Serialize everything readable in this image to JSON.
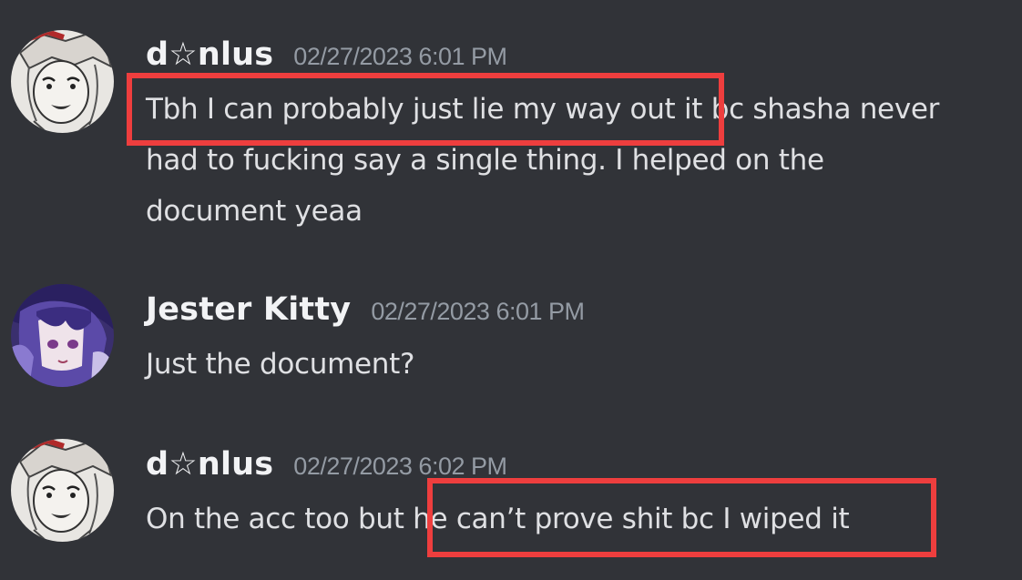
{
  "messages": [
    {
      "username": "d☆nlus",
      "timestamp": "02/27/2023 6:01 PM",
      "lines": [
        "Tbh I can probably just lie my way out it bc shasha never",
        "had to fucking say a single thing. I helped on the",
        "document yeaa"
      ]
    },
    {
      "username": "Jester Kitty",
      "timestamp": "02/27/2023 6:01 PM",
      "lines": [
        "Just the document?"
      ]
    },
    {
      "username": "d☆nlus",
      "timestamp": "02/27/2023 6:02 PM",
      "lines": [
        "On the acc too but he can’t prove shit bc I wiped it"
      ]
    }
  ],
  "colors": {
    "background": "#313338",
    "username": "#f2f3f5",
    "timestamp": "#949ba4",
    "message_text": "#dfe0e3",
    "highlight_box": "#ee3e3e"
  }
}
